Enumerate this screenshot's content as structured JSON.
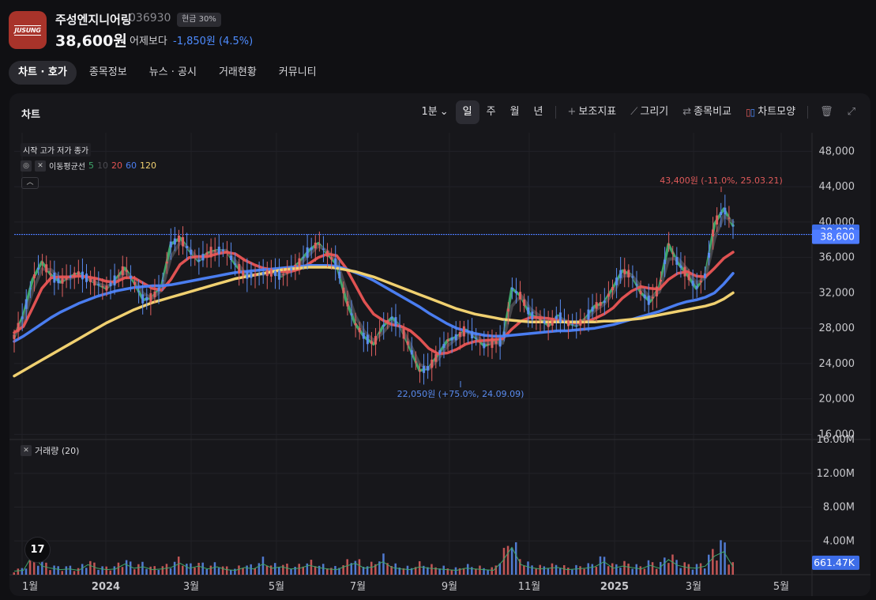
{
  "header": {
    "logo_text": "JUSUNG",
    "stock_name": "주성엔지니어링",
    "stock_code": "036930",
    "cash_badge": "현금 30%",
    "price": "38,600원",
    "compare_label": "어제보다",
    "change": "-1,850원 (4.5%)",
    "accent_color": "#4e8cff",
    "logo_color": "#a8332a"
  },
  "tabs": [
    {
      "label": "차트 · 호가",
      "active": true
    },
    {
      "label": "종목정보"
    },
    {
      "label": "뉴스 · 공시"
    },
    {
      "label": "거래현황"
    },
    {
      "label": "커뮤니티"
    }
  ],
  "panel": {
    "title": "차트",
    "toolbar": {
      "interval": "1분",
      "periods": [
        "일",
        "주",
        "월",
        "년"
      ],
      "active_period": "일",
      "indicator": "보조지표",
      "draw": "그리기",
      "compare": "종목비교",
      "shape": "차트모양"
    },
    "legend": {
      "ohlc": "시작 고가 저가 종가",
      "ma_title": "이동평균선",
      "ma_periods": [
        {
          "label": "5",
          "color": "#3fa66a"
        },
        {
          "label": "10",
          "color": "#4a4a50"
        },
        {
          "label": "20",
          "color": "#e05252"
        },
        {
          "label": "60",
          "color": "#4a7df0"
        },
        {
          "label": "120",
          "color": "#f0d070"
        }
      ]
    },
    "volume_label": "거래량 (20)",
    "tv_logo": "17"
  },
  "chart_data": {
    "type": "line",
    "price_axis": {
      "ticks": [
        "48,000",
        "44,000",
        "40,000",
        "36,000",
        "32,000",
        "28,000",
        "24,000",
        "20,000",
        "16,000"
      ],
      "range": [
        15500,
        49200
      ]
    },
    "volume_axis": {
      "ticks": [
        "16.00M",
        "12.00M",
        "8.00M",
        "4.00M"
      ],
      "range": [
        0,
        16000000
      ]
    },
    "x_ticks": [
      "1월",
      "2024",
      "3월",
      "5월",
      "7월",
      "9월",
      "11월",
      "2025",
      "3월",
      "5월"
    ],
    "current_price_label": "38,600",
    "crosshair_label": "38,828",
    "volume_current_label": "661.47K",
    "high_annotation": "43,400원 (-11.0%, 25.03.21)",
    "low_annotation": "22,050원 (+75.0%, 24.09.09)",
    "ma_series": [
      {
        "name": "5",
        "color": "#3fa66a",
        "values": [
          27000,
          29500,
          33500,
          35500,
          34000,
          33200,
          33800,
          34200,
          33600,
          33000,
          32500,
          33500,
          34800,
          33200,
          31200,
          31500,
          32800,
          37500,
          38200,
          36800,
          35600,
          36500,
          36800,
          36800,
          35200,
          34000,
          34000,
          34200,
          34300,
          33900,
          34600,
          35500,
          36800,
          37600,
          36400,
          35200,
          31200,
          28500,
          27000,
          26200,
          28200,
          29200,
          28000,
          25600,
          23200,
          23500,
          25000,
          26600,
          27000,
          27800,
          27000,
          26000,
          26400,
          26400,
          32500,
          31600,
          29500,
          29100,
          28300,
          29400,
          28600,
          28300,
          29100,
          30500,
          30900,
          32600,
          34500,
          34000,
          32000,
          31000,
          32600,
          37500,
          35400,
          34100,
          32500,
          34000,
          39800,
          41500,
          39600
        ]
      },
      {
        "name": "10",
        "color": "#4a4a50",
        "values": [
          27200,
          28800,
          32200,
          34700,
          34600,
          33600,
          33600,
          34000,
          33700,
          33100,
          32700,
          33200,
          34300,
          33600,
          31900,
          31400,
          32300,
          36000,
          37700,
          37000,
          35800,
          36200,
          36700,
          36800,
          35600,
          34300,
          34000,
          34100,
          34300,
          34000,
          34400,
          35200,
          36300,
          37300,
          36700,
          35600,
          32400,
          29400,
          27600,
          26600,
          27500,
          28700,
          28100,
          26100,
          23900,
          23400,
          24500,
          26000,
          26800,
          27600,
          27200,
          26400,
          26300,
          26300,
          30500,
          31700,
          30200,
          29400,
          28600,
          29200,
          28800,
          28400,
          28900,
          30000,
          30700,
          32000,
          33900,
          34000,
          32700,
          31400,
          32100,
          35800,
          35900,
          34700,
          33100,
          33700,
          38200,
          40700,
          40000
        ]
      },
      {
        "name": "20",
        "color": "#e05252",
        "values": [
          27500,
          28200,
          30300,
          32500,
          33700,
          33800,
          33800,
          33900,
          33800,
          33600,
          33300,
          33200,
          33700,
          33700,
          33100,
          32500,
          32300,
          33500,
          35200,
          36000,
          36100,
          36100,
          36400,
          36600,
          36400,
          35700,
          35200,
          34800,
          34600,
          34400,
          34400,
          34700,
          35300,
          36000,
          36400,
          36200,
          34800,
          32900,
          31000,
          29600,
          28900,
          28400,
          28200,
          27700,
          26800,
          25700,
          25100,
          25200,
          25600,
          26200,
          26500,
          26600,
          26700,
          26800,
          27900,
          28800,
          29200,
          29200,
          29100,
          28900,
          28700,
          28600,
          28700,
          29100,
          29600,
          30300,
          31400,
          32200,
          32700,
          32500,
          32400,
          33500,
          34200,
          34400,
          33900,
          33800,
          34800,
          35900,
          36600
        ]
      },
      {
        "name": "60",
        "color": "#4a7df0",
        "values": [
          26500,
          27100,
          27800,
          28500,
          29200,
          29800,
          30300,
          30800,
          31200,
          31600,
          31900,
          32200,
          32400,
          32600,
          32700,
          32800,
          32800,
          32900,
          33100,
          33300,
          33500,
          33700,
          33900,
          34100,
          34300,
          34400,
          34500,
          34600,
          34700,
          34800,
          34900,
          35000,
          35100,
          35100,
          35100,
          35000,
          34700,
          34300,
          33900,
          33400,
          32800,
          32200,
          31600,
          31000,
          30400,
          29700,
          29100,
          28500,
          28000,
          27700,
          27400,
          27200,
          27100,
          27100,
          27200,
          27300,
          27400,
          27500,
          27600,
          27700,
          27700,
          27800,
          27900,
          28000,
          28200,
          28400,
          28700,
          29000,
          29300,
          29600,
          29900,
          30300,
          30700,
          31000,
          31200,
          31500,
          32000,
          33000,
          34200
        ]
      },
      {
        "name": "120",
        "color": "#f0d070",
        "values": [
          22600,
          23200,
          23800,
          24400,
          25000,
          25600,
          26200,
          26800,
          27400,
          28000,
          28600,
          29100,
          29600,
          30100,
          30500,
          30900,
          31200,
          31500,
          31800,
          32100,
          32400,
          32700,
          33000,
          33300,
          33600,
          33800,
          34000,
          34200,
          34400,
          34600,
          34700,
          34800,
          34900,
          34900,
          34900,
          34800,
          34600,
          34400,
          34100,
          33800,
          33400,
          33000,
          32600,
          32200,
          31800,
          31400,
          31000,
          30600,
          30200,
          29900,
          29600,
          29400,
          29200,
          29000,
          28900,
          28800,
          28700,
          28700,
          28700,
          28700,
          28700,
          28700,
          28700,
          28700,
          28800,
          28800,
          28900,
          29000,
          29100,
          29300,
          29500,
          29700,
          29900,
          30100,
          30300,
          30500,
          30800,
          31300,
          32000
        ]
      }
    ],
    "volume_millions": [
      0.5,
      0.6,
      2.8,
      1.2,
      0.9,
      0.7,
      0.8,
      0.6,
      1.4,
      0.9,
      0.7,
      0.8,
      1.5,
      0.9,
      1.1,
      0.7,
      0.8,
      1.0,
      1.6,
      0.9,
      1.2,
      0.8,
      1.1,
      0.7,
      0.6,
      1.0,
      0.8,
      1.5,
      0.9,
      1.1,
      0.8,
      0.9,
      1.3,
      1.0,
      0.8,
      0.7,
      1.2,
      1.6,
      0.9,
      1.1,
      1.8,
      1.0,
      0.8,
      0.7,
      1.1,
      0.9,
      0.8,
      0.7,
      0.6,
      0.9,
      0.8,
      0.7,
      0.6,
      1.9,
      3.8,
      1.4,
      1.0,
      0.8,
      0.9,
      1.0,
      0.7,
      0.8,
      0.9,
      1.1,
      1.8,
      0.9,
      1.2,
      1.0,
      0.8,
      1.3,
      0.9,
      2.1,
      1.3,
      1.0,
      0.9,
      1.2,
      2.6,
      3.2,
      1.1
    ]
  }
}
